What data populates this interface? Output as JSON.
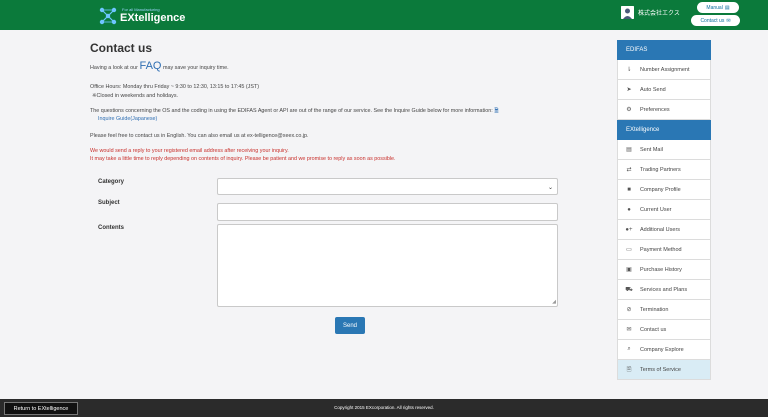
{
  "header": {
    "logo_tagline": "For all Manufacturing",
    "logo_name": "EXtelligence",
    "company_name": "株式会社エクス",
    "manual_label": "Manual",
    "contact_label": "Contact us"
  },
  "page": {
    "title": "Contact us",
    "faq_prefix": "Having a look at our",
    "faq_link": "FAQ",
    "faq_suffix": "may save your inquiry time.",
    "office_hours": "Office Hours: Monday thru Friday ~ 9:30 to 12:30, 13:15 to 17:45 (JST)",
    "closed_note": "※Closed in weekends and holidays.",
    "out_of_range": "The questions concerning the OS and the coding in using the EDIFAS Agent or API are out of the range of our service. See the Inquire Guide below for more information:",
    "guide_link": "Inquire Guide(Japanese)",
    "english_note": "Please feel free to contact us in English. You can also email us at ex-telligence@xeex.co.jp.",
    "reply_note_1": "We would send a reply to your registered email address after receiving your inquiry.",
    "reply_note_2": "It may take a little time to reply depending on contents of inquiry. Please be patient and we promise to reply as soon as possible."
  },
  "form": {
    "category_label": "Category",
    "category_value": "",
    "subject_label": "Subject",
    "subject_value": "",
    "contents_label": "Contents",
    "contents_value": "",
    "send_label": "Send"
  },
  "sidebar": {
    "edifas_header": "EDIFAS",
    "edifas_items": [
      {
        "label": "Number Assignment",
        "icon": "number-list-icon"
      },
      {
        "label": "Auto Send",
        "icon": "paper-plane-icon"
      },
      {
        "label": "Preferences",
        "icon": "gear-icon"
      }
    ],
    "ext_header": "EXtelligence",
    "ext_items": [
      {
        "label": "Sent Mail",
        "icon": "document-icon"
      },
      {
        "label": "Trading Partners",
        "icon": "handshake-icon"
      },
      {
        "label": "Company Profile",
        "icon": "briefcase-icon"
      },
      {
        "label": "Current User",
        "icon": "user-icon"
      },
      {
        "label": "Additional Users",
        "icon": "user-plus-icon"
      },
      {
        "label": "Payment Method",
        "icon": "credit-card-icon"
      },
      {
        "label": "Purchase History",
        "icon": "money-icon"
      },
      {
        "label": "Services and Plans",
        "icon": "cart-icon"
      },
      {
        "label": "Termination",
        "icon": "ban-icon"
      },
      {
        "label": "Contact us",
        "icon": "envelope-icon"
      },
      {
        "label": "Company Explore",
        "icon": "search-icon"
      },
      {
        "label": "Terms of Service",
        "icon": "document-icon"
      }
    ]
  },
  "footer": {
    "return_label": "Return to EXtelligence",
    "copyright": "Copyright 2015 EXcorporation. All rights reserved."
  }
}
